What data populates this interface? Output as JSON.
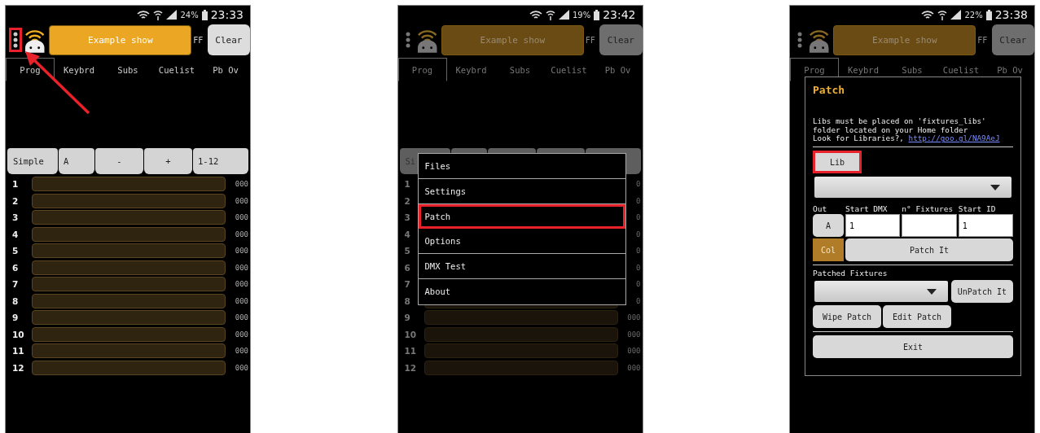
{
  "screens": [
    {
      "dimmed": false,
      "arrow": true,
      "status_bar": {
        "battery": "24%",
        "time": "23:33"
      },
      "header": {
        "menu_highlighted": true,
        "show_name": "Example show",
        "ff": "FF",
        "clear": "Clear"
      },
      "tabs": [
        {
          "label": "Prog",
          "selected": true
        },
        {
          "label": "Keybrd",
          "selected": false
        },
        {
          "label": "Subs",
          "selected": false
        },
        {
          "label": "Cuelist",
          "selected": false
        },
        {
          "label": "Pb Ov",
          "selected": false
        }
      ],
      "toolbar": [
        {
          "label": "Simple"
        },
        {
          "label": "A"
        },
        {
          "label": "-"
        },
        {
          "label": "+"
        },
        {
          "label": "1-12"
        }
      ],
      "channels": [
        {
          "number": "1",
          "value": "000"
        },
        {
          "number": "2",
          "value": "000"
        },
        {
          "number": "3",
          "value": "000"
        },
        {
          "number": "4",
          "value": "000"
        },
        {
          "number": "5",
          "value": "000"
        },
        {
          "number": "6",
          "value": "000"
        },
        {
          "number": "7",
          "value": "000"
        },
        {
          "number": "8",
          "value": "000"
        },
        {
          "number": "9",
          "value": "000"
        },
        {
          "number": "10",
          "value": "000"
        },
        {
          "number": "11",
          "value": "000"
        },
        {
          "number": "12",
          "value": "000"
        }
      ]
    },
    {
      "dimmed": true,
      "arrow": false,
      "status_bar": {
        "battery": "19%",
        "time": "23:42"
      },
      "header": {
        "menu_highlighted": false,
        "show_name": "Example show",
        "ff": "FF",
        "clear": "Clear"
      },
      "tabs": [
        {
          "label": "Prog",
          "selected": true
        },
        {
          "label": "Keybrd",
          "selected": false
        },
        {
          "label": "Subs",
          "selected": false
        },
        {
          "label": "Cuelist",
          "selected": false
        },
        {
          "label": "Pb Ov",
          "selected": false
        }
      ],
      "toolbar": [
        {
          "label": "Si"
        }
      ],
      "channels": [
        {
          "number": "1",
          "value": "0"
        },
        {
          "number": "2",
          "value": "0"
        },
        {
          "number": "3",
          "value": "0"
        },
        {
          "number": "4",
          "value": "0"
        },
        {
          "number": "5",
          "value": "0"
        },
        {
          "number": "6",
          "value": "0"
        },
        {
          "number": "7",
          "value": "0"
        },
        {
          "number": "8",
          "value": "0"
        },
        {
          "number": "9",
          "value": "000"
        },
        {
          "number": "10",
          "value": "000"
        },
        {
          "number": "11",
          "value": "000"
        },
        {
          "number": "12",
          "value": "000"
        }
      ],
      "menu": [
        {
          "label": "Files",
          "highlighted": false
        },
        {
          "label": "Settings",
          "highlighted": false
        },
        {
          "label": "Patch",
          "highlighted": true
        },
        {
          "label": "Options",
          "highlighted": false
        },
        {
          "label": "DMX Test",
          "highlighted": false
        },
        {
          "label": "About",
          "highlighted": false
        }
      ]
    },
    {
      "dimmed": true,
      "arrow": false,
      "status_bar": {
        "battery": "22%",
        "time": "23:38"
      },
      "header": {
        "menu_highlighted": false,
        "show_name": "Example show",
        "ff": "FF",
        "clear": "Clear"
      },
      "tabs": [
        {
          "label": "Prog",
          "selected": true
        },
        {
          "label": "Keybrd",
          "selected": false
        },
        {
          "label": "Subs",
          "selected": false
        },
        {
          "label": "Cuelist",
          "selected": false
        },
        {
          "label": "Pb Ov",
          "selected": false
        }
      ],
      "dialog": {
        "title": "Patch",
        "message": "Libs must be placed on 'fixtures_libs'\nfolder located on your Home folder\nLook for Libraries?,",
        "link": "http://goo.gl/NA9AeJ",
        "lib_button": {
          "label": "Lib",
          "highlighted": true
        },
        "columns": [
          "Out",
          "Start DMX",
          "n° Fixtures",
          "Start ID"
        ],
        "out_button": "A",
        "start_dmx": "1",
        "start_id": "1",
        "col_button": "Col",
        "patch_button": "Patch It",
        "patched_label": "Patched Fixtures",
        "unpatch_button": "UnPatch It",
        "wipe_button": "Wipe Patch",
        "edit_button": "Edit Patch",
        "exit_button": "Exit"
      }
    }
  ]
}
